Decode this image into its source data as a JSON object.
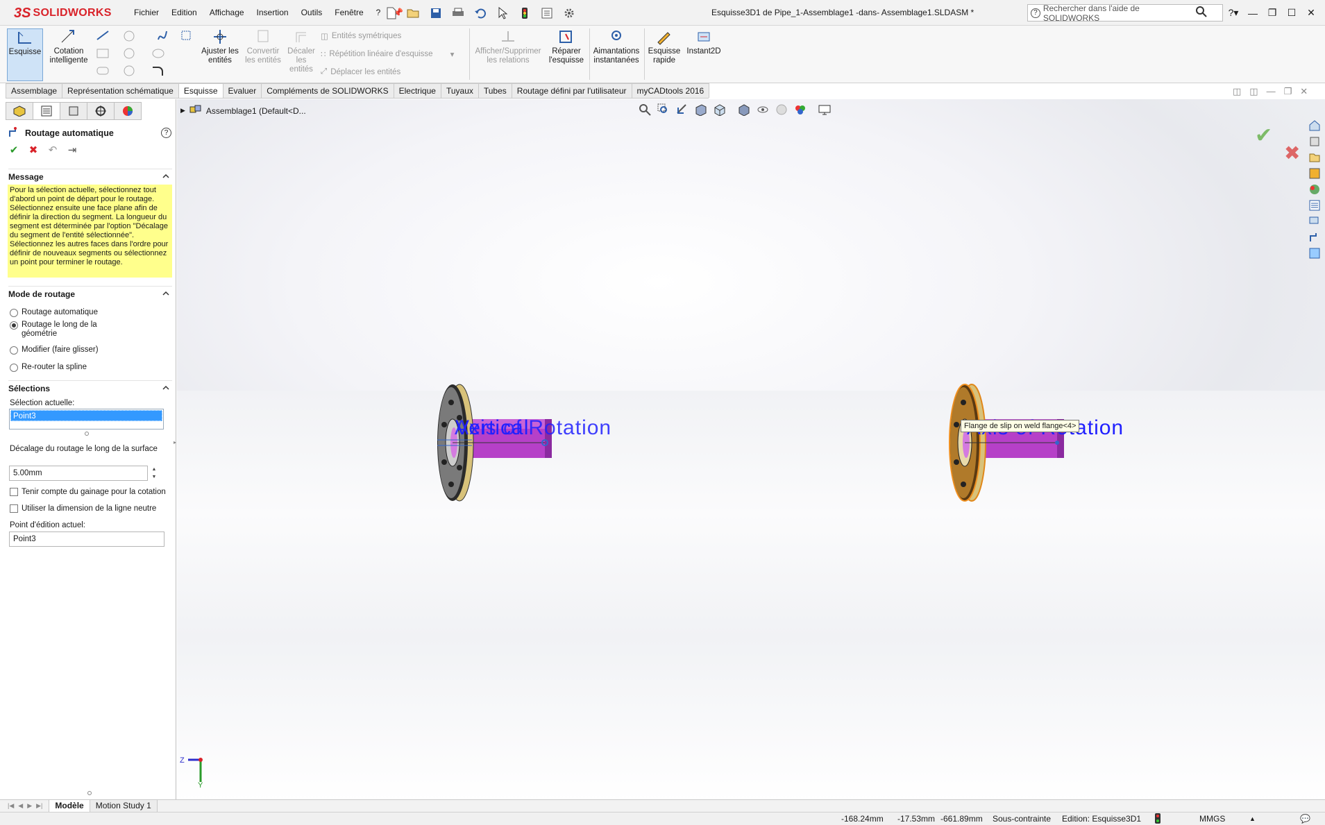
{
  "app": {
    "logo_ds": "3S",
    "logo_name": "SOLIDWORKS"
  },
  "menu": [
    "Fichier",
    "Edition",
    "Affichage",
    "Insertion",
    "Outils",
    "Fenêtre",
    "?"
  ],
  "document_title": "Esquisse3D1 de Pipe_1-Assemblage1 -dans- Assemblage1.SLDASM *",
  "help_search": {
    "placeholder": "Rechercher dans l'aide de SOLIDWORKS"
  },
  "ribbon": {
    "esquisse": "Esquisse",
    "cotation": "Cotation intelligente",
    "ajuster": "Ajuster les entités",
    "convertir": "Convertir les entités",
    "decaler": "Décaler les entités",
    "entites_sym": "Entités symétriques",
    "repetition": "Répétition linéaire d'esquisse",
    "deplacer": "Déplacer les entités",
    "afficher_rel": "Afficher/Supprimer les relations",
    "reparer": "Réparer l'esquisse",
    "aimantations": "Aimantations instantanées",
    "esquisse_rapide": "Esquisse rapide",
    "instant2d": "Instant2D"
  },
  "command_tabs": [
    "Assemblage",
    "Représentation schématique",
    "Esquisse",
    "Evaluer",
    "Compléments de SOLIDWORKS",
    "Electrique",
    "Tuyaux",
    "Tubes",
    "Routage défini par l'utilisateur",
    "myCADtools 2016"
  ],
  "active_tab": "Esquisse",
  "property_manager": {
    "title": "Routage automatique",
    "help": "?",
    "message_header": "Message",
    "message": "Pour la sélection actuelle, sélectionnez tout d'abord un point de départ pour le routage. Sélectionnez ensuite une face plane afin de définir la direction du segment. La longueur du segment est déterminée par l'option \"Décalage du segment de l'entité sélectionnée\". Sélectionnez les autres faces dans l'ordre pour définir de nouveaux segments ou sélectionnez un point pour terminer le routage.",
    "mode_header": "Mode de routage",
    "modes": [
      "Routage automatique",
      "Routage le long de la géométrie",
      "Modifier (faire glisser)",
      "Re-router la spline"
    ],
    "selected_mode_index": 1,
    "selections_header": "Sélections",
    "current_selection_label": "Sélection actuelle:",
    "current_selection": "Point3",
    "offset_label": "Décalage du routage le long de la surface",
    "offset_value": "5.00mm",
    "check_gainage": "Tenir compte du gainage pour la cotation",
    "check_ligne_neutre": "Utiliser la dimension de la ligne neutre",
    "edit_point_label": "Point d'édition actuel:",
    "edit_point_value": "Point3"
  },
  "tree": {
    "node": "Assemblage1  (Default<D..."
  },
  "viewport": {
    "axis_left": "Axis of Rotation",
    "axis_left_overlap": "Vertical",
    "axis_right": "Axis of Rotation",
    "tooltip": "Flange de slip on weld flange<4>",
    "triad_z": "Z",
    "triad_y": "Y"
  },
  "bottom_tabs": [
    "Modèle",
    "Motion Study 1"
  ],
  "active_bottom_tab": "Modèle",
  "status": {
    "x": "-168.24mm",
    "y": "-17.53mm",
    "z": "-661.89mm",
    "state": "Sous-contrainte",
    "editing": "Edition: Esquisse3D1",
    "units": "MMGS"
  },
  "colors": {
    "accent": "#d9232a",
    "message_bg": "#ffff8c",
    "selection": "#3399ff",
    "axis_text": "#2020ff",
    "pipe": "#b640c8",
    "flange": "#d8c27a"
  }
}
